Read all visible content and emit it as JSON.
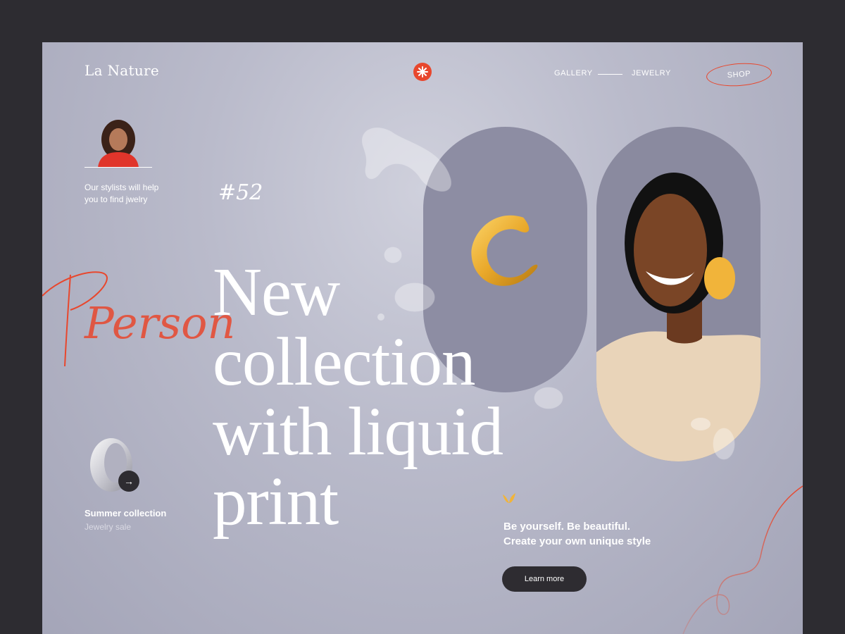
{
  "header": {
    "logo": "La Nature",
    "nav": {
      "gallery": "GALLERY",
      "jewelry": "JEWELRY",
      "shop": "SHOP"
    }
  },
  "sidebar": {
    "stylist_text_line1": "Our stylists will help",
    "stylist_text_line2": "you to find jwelry",
    "collection_title": "Summer collection",
    "collection_subtitle": "Jewelry sale"
  },
  "hero": {
    "number": "#52",
    "script_word": "Person",
    "headline": [
      "New",
      "collection",
      "with liquid",
      "print"
    ],
    "tagline_line1": "Be yourself. Be beautiful.",
    "tagline_line2": "Create your own unique style",
    "cta": "Learn more"
  },
  "colors": {
    "accent": "#e8472d",
    "gold": "#f1b43a",
    "dark": "#2e2c31",
    "background": "#babbcb"
  },
  "icons": [
    "flower-logo-icon",
    "arrow-right-icon",
    "leaf-icon"
  ]
}
